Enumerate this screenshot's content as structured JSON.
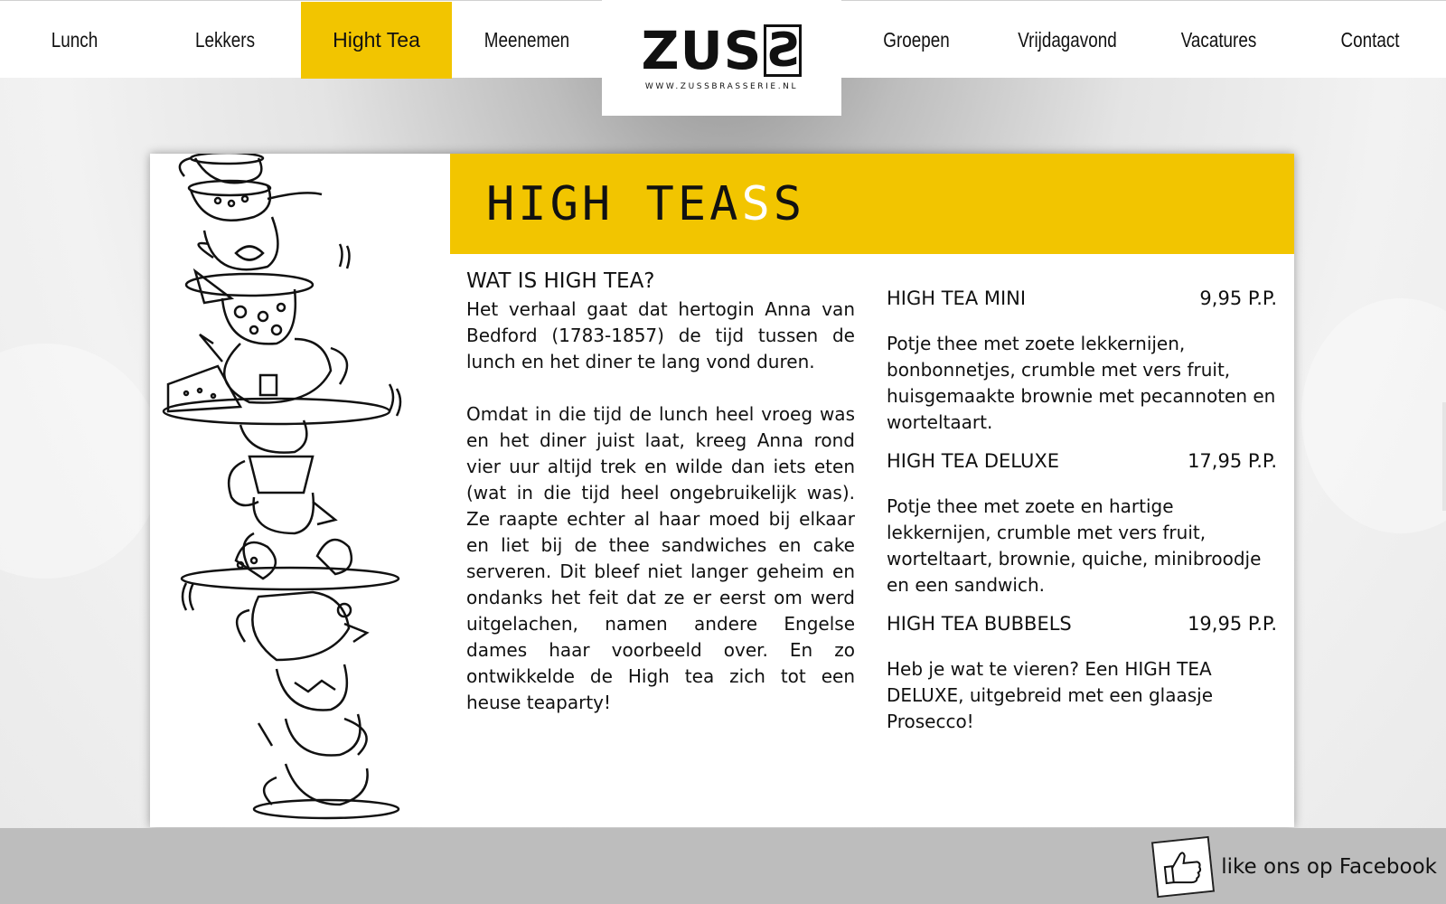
{
  "nav": {
    "left_items": [
      {
        "label": "Lunch"
      },
      {
        "label": "Lekkers"
      },
      {
        "label": "Hight Tea"
      },
      {
        "label": "Meenemen"
      }
    ],
    "right_items": [
      {
        "label": "Groepen"
      },
      {
        "label": "Vrijdagavond"
      },
      {
        "label": "Vacatures"
      },
      {
        "label": "Contact"
      }
    ],
    "active": "Hight Tea"
  },
  "logo": {
    "word_main": "ZUS",
    "word_boxed": "S",
    "url": "WWW.ZUSSBRASSERIE.NL"
  },
  "page": {
    "title_main": "HIGH TEA",
    "title_accent": "S",
    "title_tail": "S",
    "intro": {
      "heading": "WAT IS HIGH TEA?",
      "paragraph1": "Het verhaal gaat dat hertogin Anna van Bedford (1783-1857) de tijd tussen de lunch en het diner te lang vond duren.",
      "paragraph2": "Omdat in die tijd de lunch heel vroeg was en het diner juist laat, kreeg Anna rond vier uur altijd trek en wilde dan iets eten (wat in die tijd heel ongebruikelijk was). Ze raapte echter al haar moed bij elkaar en liet bij de thee sandwiches en cake serveren. Dit bleef niet langer geheim en ondanks het feit dat ze er eerst om werd uitgelachen, namen andere Engelse dames haar voorbeeld over. En zo ontwikkelde de High tea zich tot een heuse teaparty!"
    },
    "menu": [
      {
        "name": "HIGH TEA MINI",
        "price": "9,95 P.P.",
        "description": "Potje thee met zoete lekkernijen, bonbonnetjes, crumble met vers fruit, huisgemaakte brownie met pecannoten en worteltaart."
      },
      {
        "name": "HIGH TEA DELUXE",
        "price": "17,95 P.P.",
        "description": "Potje thee met zoete en hartige lekkernijen, crumble met vers fruit, worteltaart, brownie, quiche, minibroodje en een sandwich."
      },
      {
        "name": "HIGH TEA BUBBELS",
        "price": "19,95 P.P.",
        "description": "Heb je wat te vieren? Een HIGH TEA DELUXE, uitgebreid met een glaasje Prosecco!"
      }
    ]
  },
  "footer": {
    "facebook_label": "like ons op Facebook"
  },
  "colors": {
    "accent": "#f2c500",
    "footer": "#bdbdbd"
  }
}
